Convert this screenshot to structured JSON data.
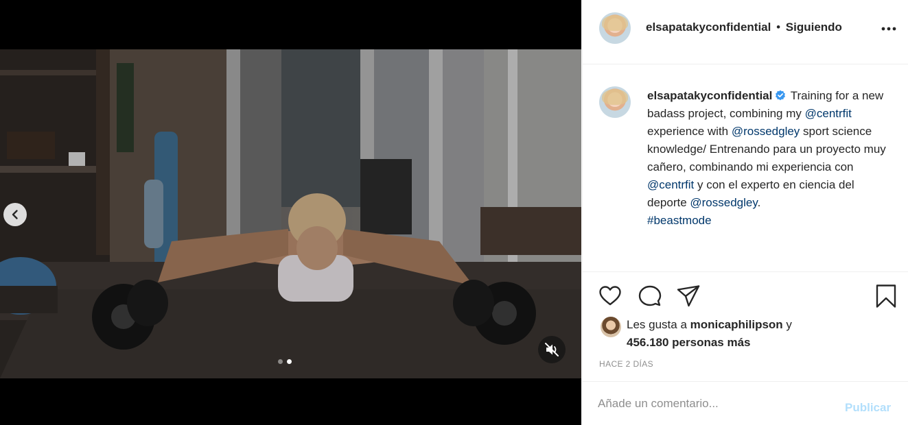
{
  "post": {
    "username": "elsapatakyconfidential",
    "separator": "•",
    "follow_status": "Siguiendo"
  },
  "caption": {
    "username": "elsapatakyconfidential",
    "text_1": " Training for a new badass project, combining my ",
    "mention_1": "@centrfit",
    "text_2": " experience with ",
    "mention_2": "@rossedgley",
    "text_3": " sport science knowledge/ Entrenando para un proyecto muy cañero, combinando mi experiencia con ",
    "mention_3": "@centrfit",
    "text_4": " y con el experto en ciencia del deporte ",
    "mention_4": "@rossedgley",
    "text_5": ".",
    "hashtag": "#beastmode"
  },
  "likes": {
    "prefix": "Les gusta a ",
    "liker": "monicaphilipson",
    "connector": " y",
    "others": "456.180 personas más"
  },
  "timestamp": "HACE 2 DÍAS",
  "comment": {
    "placeholder": "Añade un comentario...",
    "publish_label": "Publicar"
  },
  "carousel": {
    "total": 2,
    "current": 2
  },
  "colors": {
    "mention": "#00376b",
    "publish_disabled": "#b2dffc",
    "verified": "#3897f0",
    "meta_gray": "#8e8e8e"
  },
  "icons": [
    "chevron-left-icon",
    "speaker-muted-icon",
    "more-options-icon",
    "verified-badge-icon",
    "heart-icon",
    "comment-icon",
    "share-icon",
    "bookmark-icon"
  ]
}
